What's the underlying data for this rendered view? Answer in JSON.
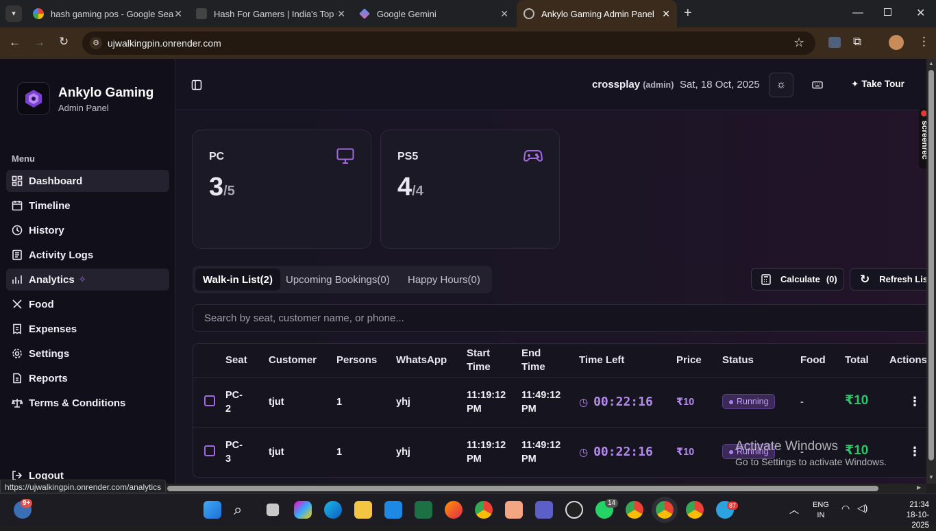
{
  "browser": {
    "tabs": [
      {
        "title": "hash gaming pos - Google Sear",
        "icon": "google-icon"
      },
      {
        "title": "Hash For Gamers | India's Top G",
        "icon": "hash-favicon"
      },
      {
        "title": "Google Gemini",
        "icon": "gemini-icon"
      },
      {
        "title": "Ankylo Gaming Admin Panel",
        "icon": "globe-icon"
      }
    ],
    "new_tab": "+",
    "url": "ujwalkingpin.onrender.com",
    "status_url": "https://ujwalkingpin.onrender.com/analytics"
  },
  "sidebar": {
    "brand": "Ankylo Gaming",
    "subtitle": "Admin Panel",
    "menu_heading": "Menu",
    "items": [
      {
        "label": "Dashboard",
        "icon": "dashboard-icon",
        "selected": true
      },
      {
        "label": "Timeline",
        "icon": "clock-icon"
      },
      {
        "label": "History",
        "icon": "history-icon"
      },
      {
        "label": "Activity Logs",
        "icon": "list-icon"
      },
      {
        "label": "Analytics",
        "icon": "chart-icon",
        "highlighted": true
      },
      {
        "label": "Food",
        "icon": "utensils-icon"
      },
      {
        "label": "Expenses",
        "icon": "receipt-icon"
      },
      {
        "label": "Settings",
        "icon": "gear-icon"
      },
      {
        "label": "Reports",
        "icon": "report-icon"
      },
      {
        "label": "Terms & Conditions",
        "icon": "scale-icon"
      }
    ],
    "logout": "Logout"
  },
  "header": {
    "user": "crossplay",
    "role": "(admin)",
    "date": "Sat, 18 Oct, 2025",
    "tour": "Take Tour"
  },
  "cards": [
    {
      "name": "PC",
      "used": "3",
      "total": "/5",
      "icon": "monitor-icon"
    },
    {
      "name": "PS5",
      "used": "4",
      "total": "/4",
      "icon": "gamepad-icon"
    }
  ],
  "tabs": [
    {
      "label": "Walk-in List(2)",
      "active": true
    },
    {
      "label": "Upcoming Bookings(0)"
    },
    {
      "label": "Happy Hours(0)"
    }
  ],
  "buttons": {
    "calculate": "Calculate",
    "calculate_count": "(0)",
    "refresh": "Refresh List"
  },
  "search": {
    "placeholder": "Search by seat, customer name, or phone..."
  },
  "table": {
    "columns": [
      "Seat",
      "Customer",
      "Persons",
      "WhatsApp",
      "Start Time",
      "End Time",
      "Time Left",
      "Price",
      "Status",
      "Food",
      "Total",
      "Actions"
    ],
    "rows": [
      {
        "seat": "PC-2",
        "customer": "tjut",
        "persons": "1",
        "whatsapp": "yhj",
        "start": "11:19:12 PM",
        "end": "11:49:12 PM",
        "time_left": "00:22:16",
        "price": "₹10",
        "status": "Running",
        "food": "-",
        "total": "₹10"
      },
      {
        "seat": "PC-3",
        "customer": "tjut",
        "persons": "1",
        "whatsapp": "yhj",
        "start": "11:19:12 PM",
        "end": "11:49:12 PM",
        "time_left": "00:22:16",
        "price": "₹10",
        "status": "Running",
        "food": "-",
        "total": "₹10"
      }
    ]
  },
  "overlay": {
    "screenrec": "screenrec",
    "activate_title": "Activate Windows",
    "activate_sub": "Go to Settings to activate Windows."
  },
  "taskbar": {
    "weather_badge": "9+",
    "lang": "ENG",
    "region": "IN",
    "time": "21:34",
    "date": "18-10-2025",
    "whatsapp_badge": "14",
    "telegram_badge": "87"
  },
  "colors": {
    "accent": "#a36bdf",
    "running": "#c79bff",
    "total": "#2ec46b",
    "chrome_toolbar": "#3a2b1d"
  }
}
